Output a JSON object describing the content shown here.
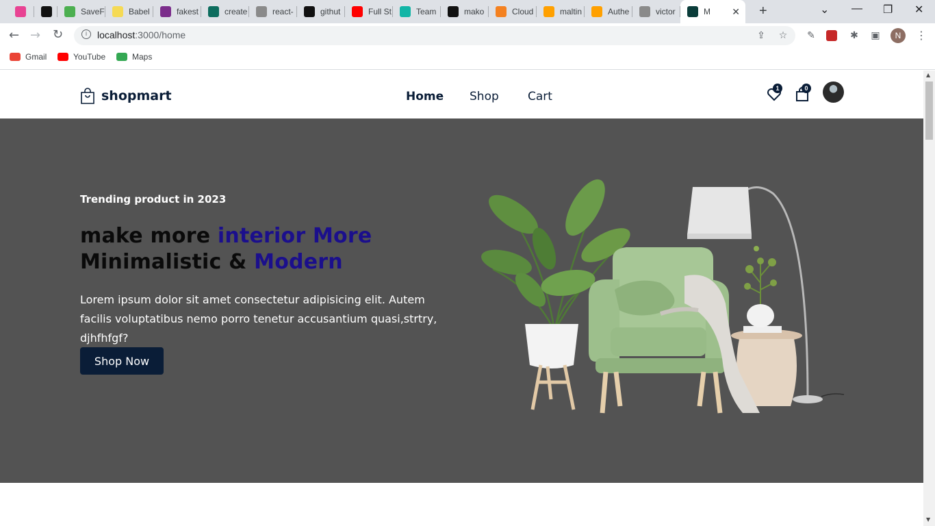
{
  "browser": {
    "tabs": [
      {
        "title": "",
        "favicon_color": "#e84393"
      },
      {
        "title": "",
        "favicon_color": "#111111"
      },
      {
        "title": "SaveF",
        "favicon_color": "#4caf50"
      },
      {
        "title": "Babel",
        "favicon_color": "#f5da55"
      },
      {
        "title": "fakest",
        "favicon_color": "#7b2d8b"
      },
      {
        "title": "create",
        "favicon_color": "#0d6d5e"
      },
      {
        "title": "react-",
        "favicon_color": "#8a8a8a"
      },
      {
        "title": "githut",
        "favicon_color": "#111111"
      },
      {
        "title": "Full St",
        "favicon_color": "#ff0000"
      },
      {
        "title": "Team",
        "favicon_color": "#12b5a6"
      },
      {
        "title": "mako",
        "favicon_color": "#111111"
      },
      {
        "title": "Cloud",
        "favicon_color": "#f48120"
      },
      {
        "title": "maltin",
        "favicon_color": "#ffa000"
      },
      {
        "title": "Authe",
        "favicon_color": "#ffa000"
      },
      {
        "title": "victor",
        "favicon_color": "#8a8a8a"
      },
      {
        "title": "M",
        "favicon_color": "#0b3d3a"
      }
    ],
    "new_tab": "+",
    "window_controls": {
      "dropdown": "⌄",
      "minimize": "—",
      "restore": "❐",
      "close": "✕"
    },
    "url_host": "localhost",
    "url_path": ":3000/home",
    "profile_initial": "N",
    "bookmarks": [
      {
        "label": "Gmail",
        "color": "#ea4335"
      },
      {
        "label": "YouTube",
        "color": "#ff0000"
      },
      {
        "label": "Maps",
        "color": "#34a853"
      }
    ]
  },
  "site": {
    "logo": "shopmart",
    "nav": [
      "Home",
      "Shop",
      "Cart"
    ],
    "wishlist_count": "1",
    "cart_count": "0"
  },
  "hero": {
    "subtitle": "Trending product in 2023",
    "title_part1": "make more ",
    "title_accent1": "interior More",
    "title_part2": "Minimalistic & ",
    "title_accent2": "Modern",
    "description": "Lorem ipsum dolor sit amet consectetur adipisicing elit. Autem facilis voluptatibus nemo porro tenetur accusantium quasi,strtry, djhfhfgf?",
    "button": "Shop Now"
  },
  "colors": {
    "primary": "#0a1d37",
    "accent": "#1b0f8c",
    "hero_bg": "#535353"
  }
}
